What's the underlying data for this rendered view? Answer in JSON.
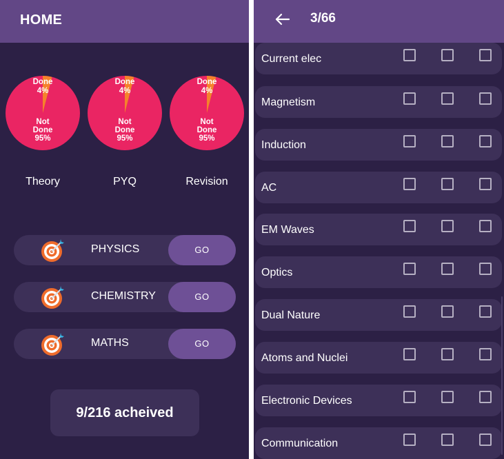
{
  "colors": {
    "background": "#2c2045",
    "appbar": "#624786",
    "card": "#3d3058",
    "go_button": "#6e5096",
    "pie_not_done": "#ea2563",
    "pie_done": "#f5822b",
    "text": "#ffffff",
    "checkbox_border": "#b6b0c3"
  },
  "home": {
    "title": "HOME",
    "pies": [
      {
        "type": "Theory",
        "done_label": "Done",
        "done_pct": "4%",
        "not_done_label_1": "Not",
        "not_done_label_2": "Done",
        "not_done_pct": "95%",
        "done_fraction": 0.04
      },
      {
        "type": "PYQ",
        "done_label": "Done",
        "done_pct": "4%",
        "not_done_label_1": "Not",
        "not_done_label_2": "Done",
        "not_done_pct": "95%",
        "done_fraction": 0.04
      },
      {
        "type": "Revision",
        "done_label": "Done",
        "done_pct": "4%",
        "not_done_label_1": "Not",
        "not_done_label_2": "Done",
        "not_done_pct": "95%",
        "done_fraction": 0.04
      }
    ],
    "subjects": [
      {
        "name": "PHYSICS",
        "icon": "target-icon",
        "button": "GO"
      },
      {
        "name": "CHEMISTRY",
        "icon": "target-icon",
        "button": "GO"
      },
      {
        "name": "MATHS",
        "icon": "target-icon",
        "button": "GO"
      }
    ],
    "achieved": "9/216 acheived"
  },
  "chapters_screen": {
    "back_icon": "arrow-left-icon",
    "page_counter": "3/66",
    "chapters": [
      {
        "name": "Current elec",
        "checked": [
          false,
          false,
          false
        ]
      },
      {
        "name": "Magnetism",
        "checked": [
          false,
          false,
          false
        ]
      },
      {
        "name": "Induction",
        "checked": [
          false,
          false,
          false
        ]
      },
      {
        "name": "AC",
        "checked": [
          false,
          false,
          false
        ]
      },
      {
        "name": "EM Waves",
        "checked": [
          false,
          false,
          false
        ]
      },
      {
        "name": "Optics",
        "checked": [
          false,
          false,
          false
        ]
      },
      {
        "name": "Dual Nature",
        "checked": [
          false,
          false,
          false
        ]
      },
      {
        "name": "Atoms and Nuclei",
        "checked": [
          false,
          false,
          false
        ]
      },
      {
        "name": "Electronic Devices",
        "checked": [
          false,
          false,
          false
        ]
      },
      {
        "name": "Communication",
        "checked": [
          false,
          false,
          false
        ]
      }
    ]
  }
}
